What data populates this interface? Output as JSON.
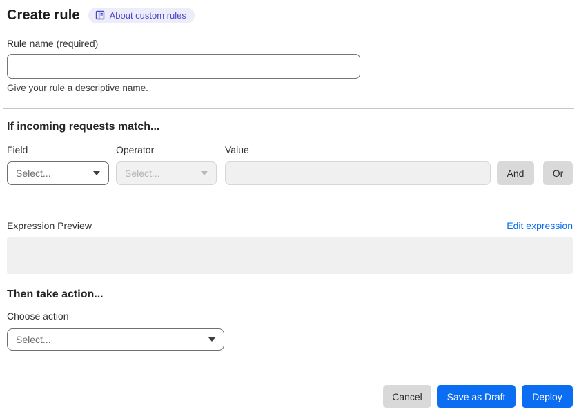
{
  "header": {
    "title": "Create rule",
    "about_badge_label": "About custom rules"
  },
  "rule_name": {
    "label": "Rule name (required)",
    "value": "",
    "helper": "Give your rule a descriptive name."
  },
  "match_section": {
    "heading": "If incoming requests match...",
    "field": {
      "label": "Field",
      "selected": "Select..."
    },
    "operator": {
      "label": "Operator",
      "selected": "Select...",
      "disabled": true
    },
    "value": {
      "label": "Value",
      "value": "",
      "disabled": true
    },
    "and_button_label": "And",
    "or_button_label": "Or",
    "expression_preview_label": "Expression Preview",
    "edit_expression_label": "Edit expression",
    "expression_value": ""
  },
  "action_section": {
    "heading": "Then take action...",
    "choose_action_label": "Choose action",
    "action_select": {
      "selected": "Select..."
    }
  },
  "footer": {
    "cancel_label": "Cancel",
    "save_draft_label": "Save as Draft",
    "deploy_label": "Deploy"
  },
  "colors": {
    "primary_blue": "#0b6df1",
    "link_blue": "#0b6cf2",
    "badge_bg": "#ececfb",
    "badge_text": "#4747c7",
    "disabled_bg": "#f1f1f1",
    "gray_button_bg": "#d9d9d9"
  }
}
